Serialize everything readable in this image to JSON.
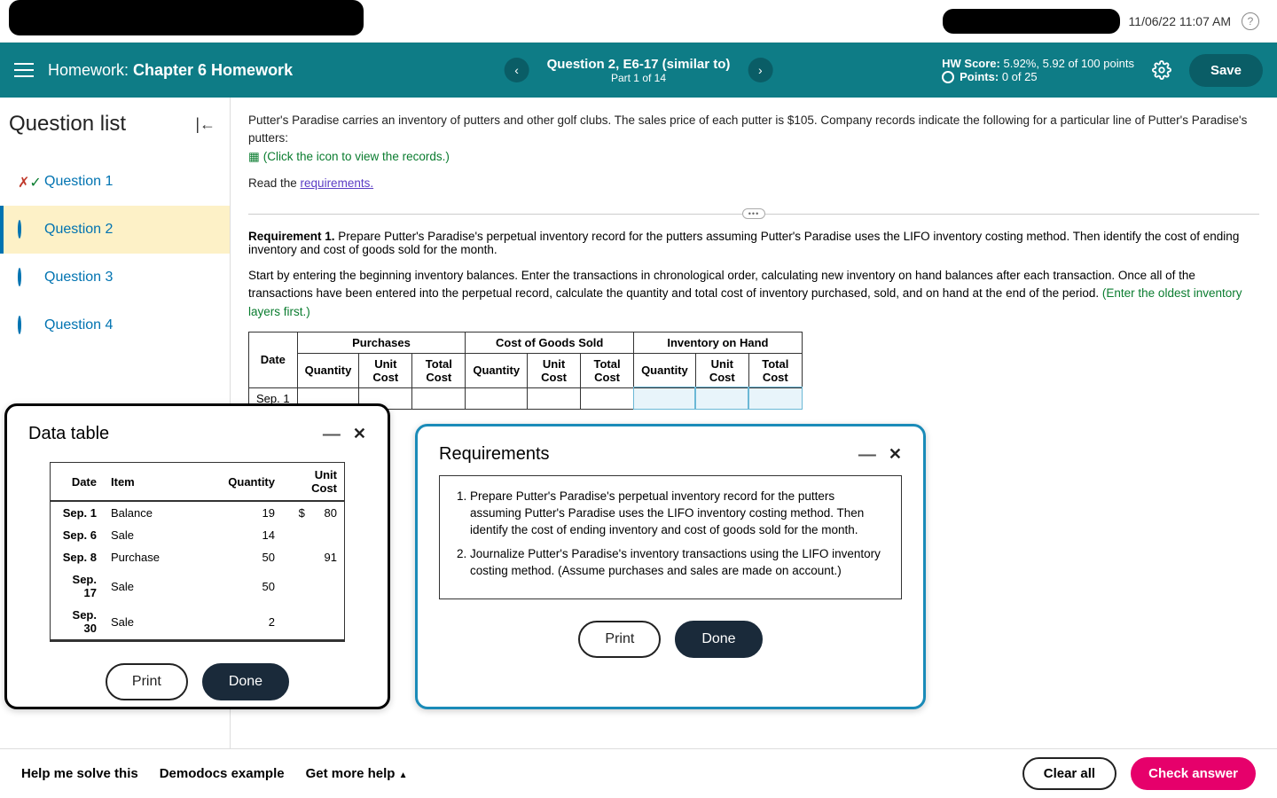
{
  "topbar": {
    "timestamp": "11/06/22 11:07 AM"
  },
  "header": {
    "hw_prefix": "Homework: ",
    "hw_name": "Chapter 6 Homework",
    "question_title": "Question 2, E6-17 (similar to)",
    "part": "Part 1 of 14",
    "hw_score_label": "HW Score:",
    "hw_score_value": "5.92%, 5.92 of 100 points",
    "points_label": "Points:",
    "points_value": "0 of 25",
    "save": "Save"
  },
  "sidebar": {
    "title": "Question list",
    "items": [
      {
        "label": "Question 1",
        "status": "partial"
      },
      {
        "label": "Question 2",
        "status": "current"
      },
      {
        "label": "Question 3",
        "status": "open"
      },
      {
        "label": "Question 4",
        "status": "open"
      }
    ]
  },
  "content": {
    "intro": "Putter's Paradise carries an inventory of putters and other golf clubs. The sales price of each putter is $105. Company records indicate the following for a particular line of Putter's Paradise's putters:",
    "records_link": "(Click the icon to view the records.)",
    "read_prefix": "Read the ",
    "req_link": "requirements.",
    "req1_label": "Requirement 1.",
    "req1_text": "Prepare Putter's Paradise's perpetual inventory record for the putters assuming Putter's Paradise uses the LIFO inventory costing method. Then identify the cost of ending inventory and cost of goods sold for the month.",
    "instructions": "Start by entering the beginning inventory balances. Enter the transactions in chronological order, calculating new inventory on hand balances after each transaction. Once all of the transactions have been entered into the perpetual record, calculate the quantity and total cost of inventory purchased, sold, and on hand at the end of the period. ",
    "instructions_note": "(Enter the oldest inventory layers first.)",
    "table": {
      "group_headers": [
        "Purchases",
        "Cost of Goods Sold",
        "Inventory on Hand"
      ],
      "col_headers": [
        "Date",
        "Quantity",
        "Unit Cost",
        "Total Cost",
        "Quantity",
        "Unit Cost",
        "Total Cost",
        "Quantity",
        "Unit Cost",
        "Total Cost"
      ],
      "first_date": "Sep. 1"
    }
  },
  "datatable_popup": {
    "title": "Data table",
    "headers": [
      "Date",
      "Item",
      "Quantity",
      "Unit Cost"
    ],
    "rows": [
      {
        "date": "Sep. 1",
        "item": "Balance",
        "qty": "19",
        "cost_prefix": "$",
        "cost": "80"
      },
      {
        "date": "Sep. 6",
        "item": "Sale",
        "qty": "14",
        "cost_prefix": "",
        "cost": ""
      },
      {
        "date": "Sep. 8",
        "item": "Purchase",
        "qty": "50",
        "cost_prefix": "",
        "cost": "91"
      },
      {
        "date": "Sep. 17",
        "item": "Sale",
        "qty": "50",
        "cost_prefix": "",
        "cost": ""
      },
      {
        "date": "Sep. 30",
        "item": "Sale",
        "qty": "2",
        "cost_prefix": "",
        "cost": ""
      }
    ],
    "print": "Print",
    "done": "Done"
  },
  "requirements_popup": {
    "title": "Requirements",
    "items": [
      "Prepare Putter's Paradise's perpetual inventory record for the putters assuming Putter's Paradise uses the LIFO inventory costing method. Then identify the cost of ending inventory and cost of goods sold for the month.",
      "Journalize Putter's Paradise's inventory transactions using the LIFO inventory costing method. (Assume purchases and sales are made on account.)"
    ],
    "print": "Print",
    "done": "Done"
  },
  "footer": {
    "help": "Help me solve this",
    "demo": "Demodocs example",
    "more": "Get more help",
    "clear": "Clear all",
    "check": "Check answer"
  }
}
